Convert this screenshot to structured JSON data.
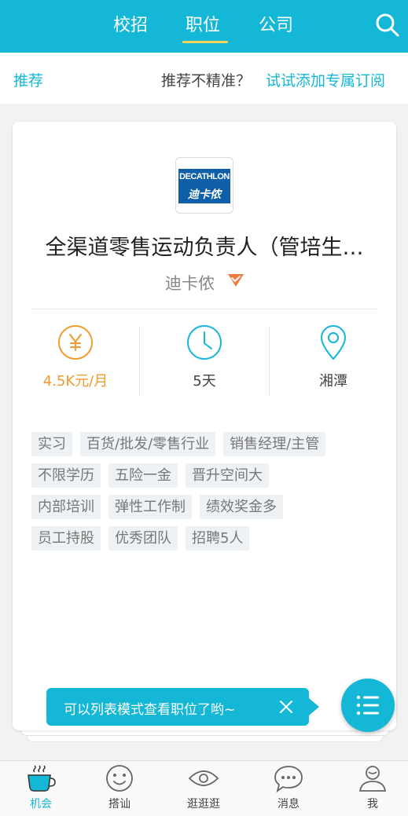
{
  "top_tabs": [
    "校招",
    "职位",
    "公司"
  ],
  "subbar": {
    "recommend": "推荐",
    "hint": "推荐不精准？",
    "subscribe_link": "试试添加专属订阅"
  },
  "job": {
    "logo_en": "DECATHLON",
    "logo_cn": "迪卡侬",
    "title": "全渠道零售运动负责人（管培生…",
    "company": "迪卡侬",
    "salary": "4.5K元/月",
    "duration": "5天",
    "location": "湘潭",
    "tags": [
      [
        "实习",
        "百货/批发/零售行业",
        "销售经理/主管"
      ],
      [
        "不限学历",
        "五险一金",
        "晋升空间大"
      ],
      [
        "内部培训",
        "弹性工作制",
        "绩效奖金多"
      ],
      [
        "员工持股",
        "优秀团队",
        "招聘5人"
      ]
    ]
  },
  "toast": {
    "text": "可以列表模式查看职位了哟~"
  },
  "bottom_nav": [
    "机会",
    "搭讪",
    "逛逛逛",
    "消息",
    "我"
  ],
  "colors": {
    "accent": "#15b7d6",
    "salary": "#f39a2e",
    "verified": "#f07a3a",
    "underline": "#f7d35a"
  },
  "icons": {
    "search": "search-icon",
    "verified": "verified-icon",
    "salary": "yen-icon",
    "duration": "clock-icon",
    "location": "location-pin-icon",
    "close": "close-icon",
    "list_mode": "list-icon",
    "nav": [
      "coffee-cup-icon",
      "smiley-icon",
      "eye-icon",
      "chat-bubble-icon",
      "person-icon"
    ]
  }
}
